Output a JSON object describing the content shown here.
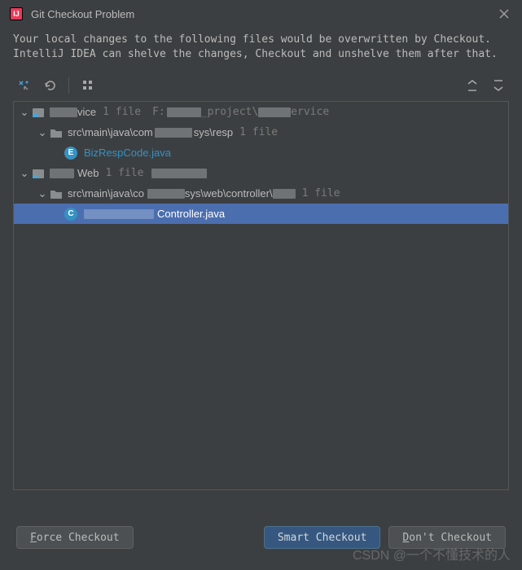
{
  "window": {
    "title": "Git Checkout Problem",
    "message_line1": "Your local changes to the following files would be overwritten by Checkout.",
    "message_line2": "IntelliJ IDEA can shelve the changes, Checkout and unshelve them after that."
  },
  "toolbar": {
    "diff_icon": "diff-icon",
    "undo_icon": "undo-icon",
    "group_icon": "group-icon",
    "expand_icon": "expand-all-icon",
    "collapse_icon": "collapse-all-icon"
  },
  "tree": {
    "module1": {
      "name_suffix": "vice",
      "count": "1 file",
      "path_prefix": "F:",
      "path_mid": "_project\\",
      "path_suffix": "ervice"
    },
    "folder1": {
      "path": "src\\main\\java\\com",
      "path_suffix": "sys\\resp",
      "count": "1 file"
    },
    "file1": {
      "badge": "E",
      "name": "BizRespCode.java"
    },
    "module2": {
      "name_suffix": "Web",
      "count": "1 file"
    },
    "folder2": {
      "path_a": "src\\main\\java\\co",
      "path_b": "sys\\web\\controller\\",
      "count": "1 file"
    },
    "file2": {
      "badge": "C",
      "name_suffix": "Controller.java"
    }
  },
  "buttons": {
    "force": "Force Checkout",
    "smart": "Smart Checkout",
    "dont": "Don't Checkout"
  },
  "watermark": "CSDN @一个不懂技术的人"
}
